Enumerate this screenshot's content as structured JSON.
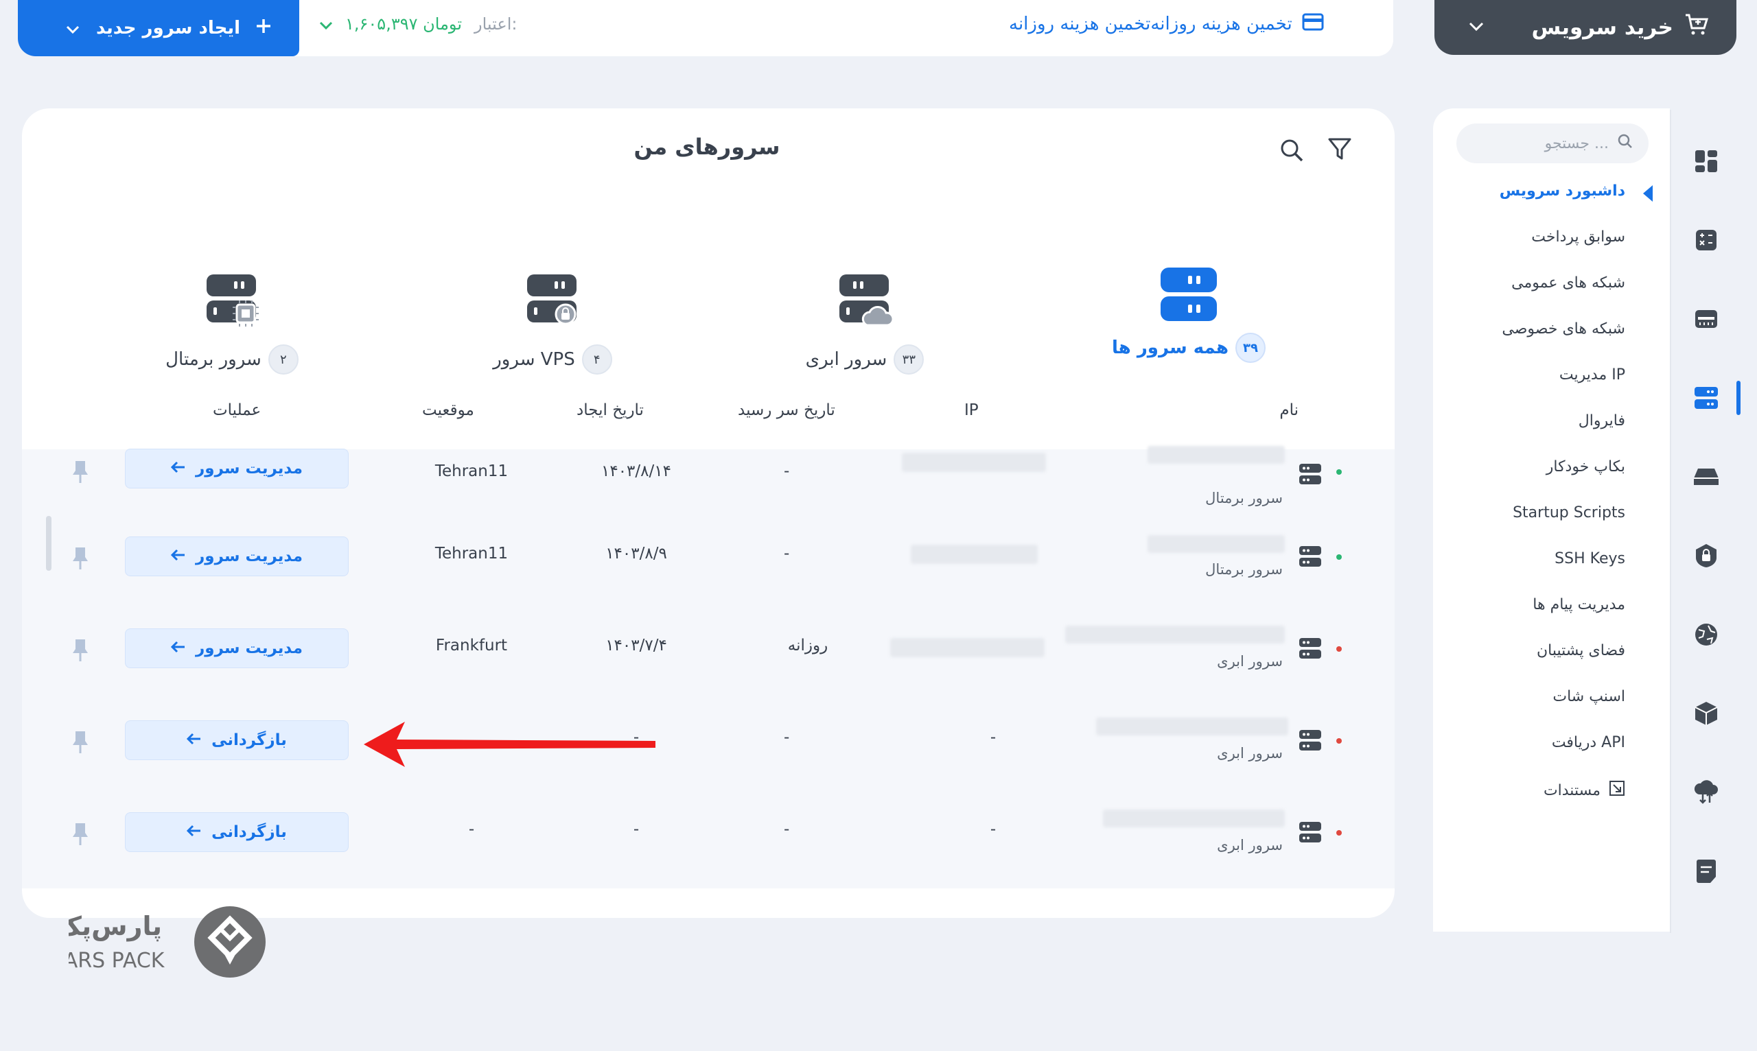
{
  "topbar": {
    "buy_service": "خرید سرویس",
    "estimate": "تخمین هزینه روزانه‌تخمین هزینه روزانه",
    "credit_label": "اعتبار:",
    "credit_value": "۱,۶۰۵,۳۹۷ تومان",
    "new_server": "ایجاد سرور جدید"
  },
  "sidebar": {
    "search_placeholder": "جستجو ...",
    "items": [
      {
        "label": "داشبورد سرویس",
        "active": true
      },
      {
        "label": "سوابق پرداخت"
      },
      {
        "label": "شبکه های عمومی"
      },
      {
        "label": "شبکه های خصوصی"
      },
      {
        "label": "مدیریت IP"
      },
      {
        "label": "فایروال"
      },
      {
        "label": "بکاپ خودکار"
      },
      {
        "label": "Startup Scripts"
      },
      {
        "label": "SSH Keys"
      },
      {
        "label": "مدیریت پیام ها"
      },
      {
        "label": "فضای پشتیبان"
      },
      {
        "label": "اسنپ شات"
      },
      {
        "label": "دریافت API"
      },
      {
        "label": "مستندات"
      }
    ]
  },
  "main": {
    "title": "سرورهای من",
    "categories": [
      {
        "label": "همه سرور ها",
        "count": "۳۹",
        "active": true
      },
      {
        "label": "سرور ابری",
        "count": "۳۳"
      },
      {
        "label": "سرور VPS",
        "count": "۴"
      },
      {
        "label": "سرور برمتال",
        "count": "۲"
      }
    ],
    "columns": {
      "name": "نام",
      "ip": "IP",
      "due": "تاریخ سر رسید",
      "created": "تاریخ ایجاد",
      "location": "موقعیت",
      "ops": "عملیات"
    },
    "rows": [
      {
        "type": "سرور برمتال",
        "due": "-",
        "created": "۱۴۰۳/۸/۱۴",
        "location": "Tehran11",
        "action": "مدیریت سرور",
        "status": "green"
      },
      {
        "type": "سرور برمتال",
        "due": "-",
        "created": "۱۴۰۳/۸/۹",
        "location": "Tehran11",
        "action": "مدیریت سرور",
        "status": "green"
      },
      {
        "type": "سرور ابری",
        "due": "روزانه",
        "created": "۱۴۰۳/۷/۴",
        "location": "Frankfurt",
        "action": "مدیریت سرور",
        "status": "red"
      },
      {
        "type": "سرور ابری",
        "ip": "-",
        "due": "-",
        "created": "-",
        "location": "",
        "action": "بازگردانی",
        "status": "red"
      },
      {
        "type": "سرور ابری",
        "ip": "-",
        "due": "-",
        "created": "-",
        "location": "-",
        "action": "بازگردانی",
        "status": "red"
      }
    ]
  },
  "logo": {
    "fa": "پارس‌پک",
    "en": "PARS PACK"
  },
  "colors": {
    "accent": "#1873e6",
    "dark": "#434b55",
    "green": "#2bb673",
    "red": "#e0493f"
  }
}
